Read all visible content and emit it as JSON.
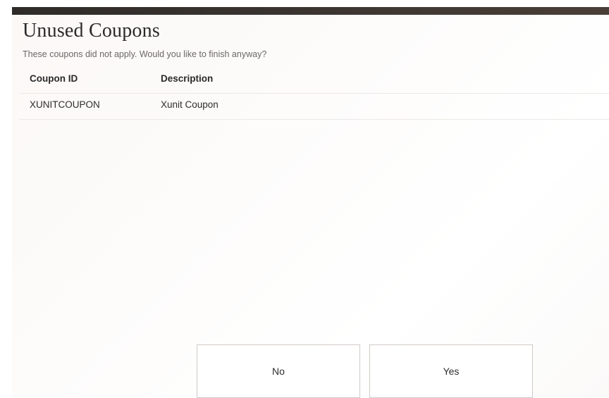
{
  "dialog": {
    "title": "Unused Coupons",
    "subtitle": "These coupons did not apply. Would you like to finish anyway?"
  },
  "table": {
    "headers": {
      "coupon_id": "Coupon ID",
      "description": "Description"
    },
    "rows": [
      {
        "coupon_id": "XUNITCOUPON",
        "description": "Xunit Coupon"
      }
    ]
  },
  "buttons": {
    "no_label": "No",
    "yes_label": "Yes"
  },
  "colors": {
    "top_bar": "#2f2b28",
    "text": "#2e2d2c",
    "subtitle": "#6b6866",
    "button_border": "#cfcac6"
  }
}
